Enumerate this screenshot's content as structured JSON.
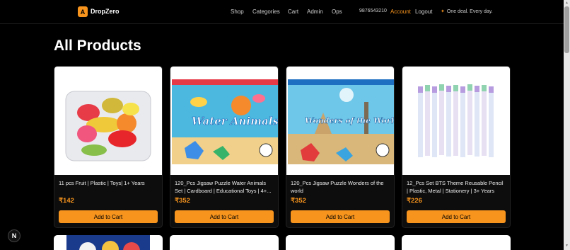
{
  "header": {
    "logo_letter": "A",
    "brand": "DropZero",
    "nav": [
      "Shop",
      "Categories",
      "Cart",
      "Admin",
      "Ops"
    ],
    "phone": "9876543210",
    "account": "Account",
    "logout": "Logout",
    "deal": "One deal. Every day."
  },
  "page_title": "All Products",
  "products": [
    {
      "name": "11 pcs Fruit | Plastic | Toys| 1+ Years",
      "price": "₹142",
      "cta": "Add to Cart"
    },
    {
      "name": "120_Pcs Jigsaw Puzzle Water Animals Set | Cardboard | Educational Toys | 4+...",
      "price": "₹352",
      "cta": "Add to Cart",
      "image_text": "Water Animals"
    },
    {
      "name": "120_Pcs Jigsaw Puzzle Wonders of the world",
      "price": "₹352",
      "cta": "Add to Cart",
      "image_text": "Wonders of the World"
    },
    {
      "name": "12_Pcs Set BTS Theme Reusable Pencil | Plastic, Metal | Stationery | 3+ Years",
      "price": "₹226",
      "cta": "Add to Cart"
    }
  ],
  "nextjs_badge": "N"
}
